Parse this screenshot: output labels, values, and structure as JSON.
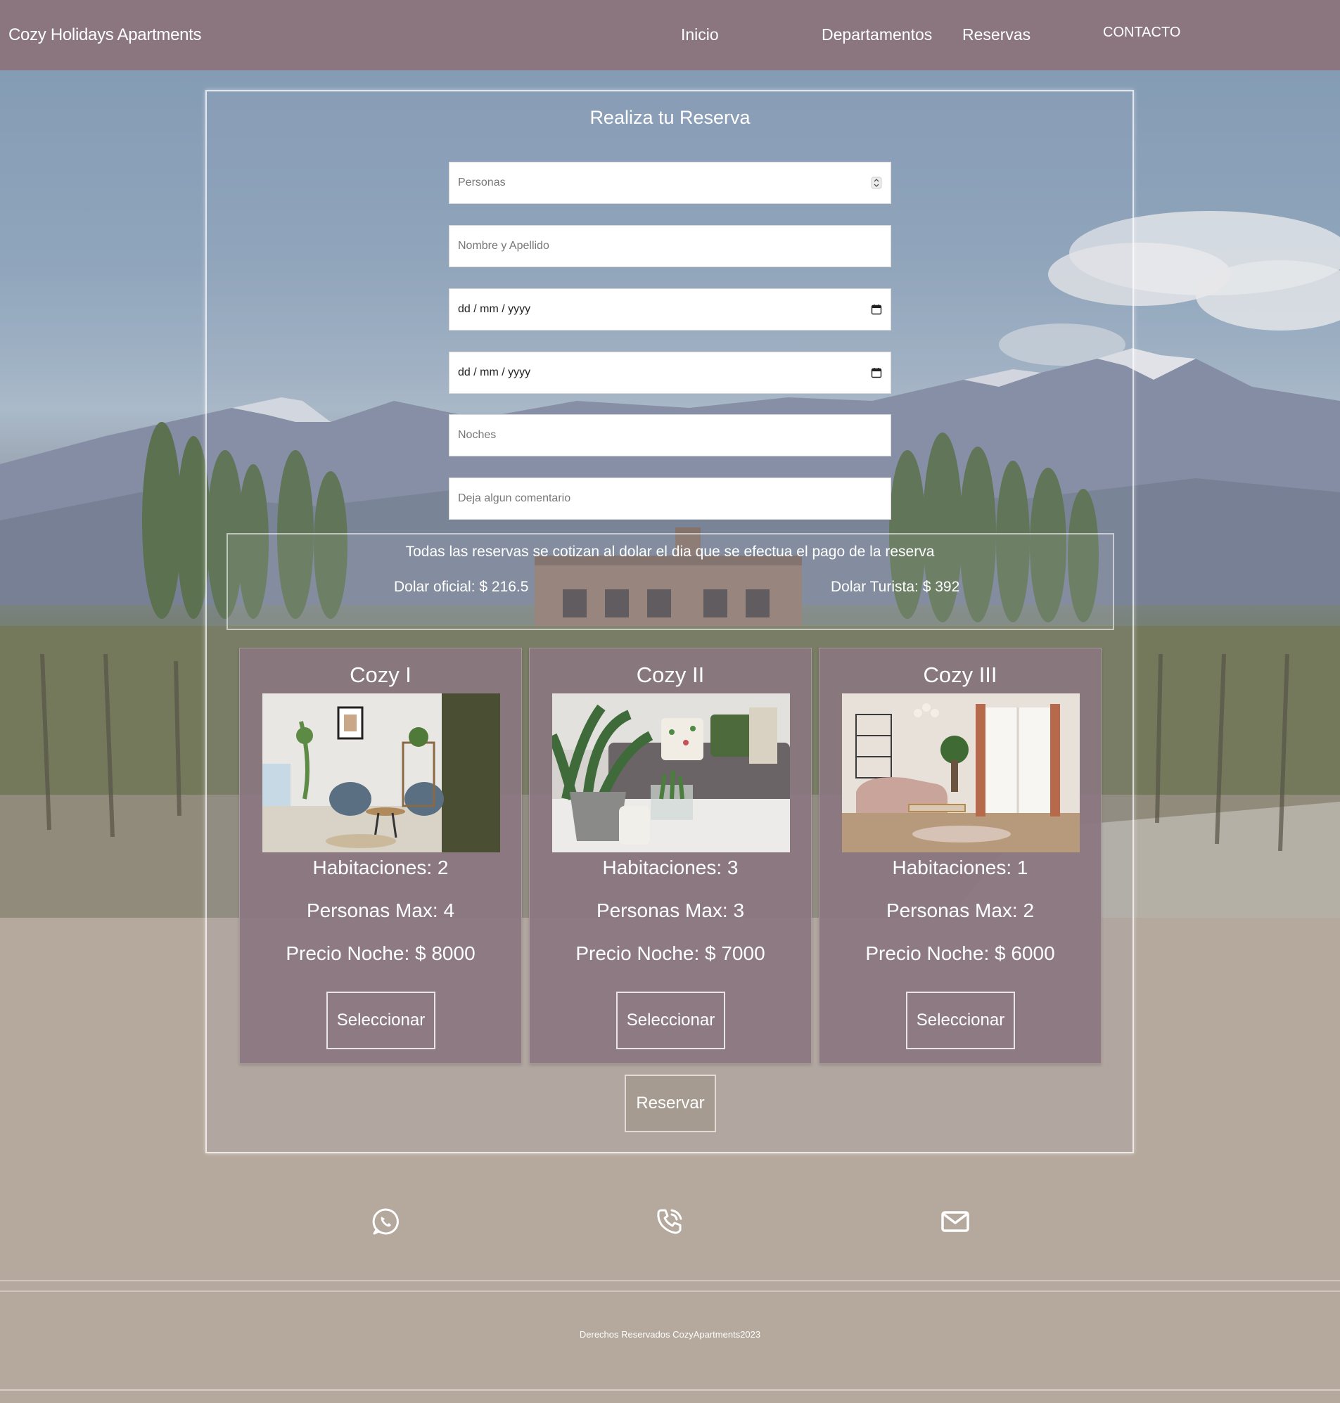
{
  "header": {
    "brand": "Cozy Holidays Apartments",
    "nav": {
      "inicio": "Inicio",
      "departamentos": "Departamentos",
      "reservas": "Reservas",
      "contacto": "CONTACTO"
    }
  },
  "form": {
    "title": "Realiza tu Reserva",
    "personas_placeholder": "Personas",
    "nombre_placeholder": "Nombre y Apellido",
    "fecha_entrada": "dd / mm / yyyy",
    "fecha_salida": "dd / mm / yyyy",
    "noches_placeholder": "Noches",
    "comentario_placeholder": "Deja algun comentario"
  },
  "notice": {
    "text": "Todas las reservas se cotizan al dolar el dia que se efectua el pago de la reserva",
    "dolar_oficial": "Dolar oficial: $ 216.5",
    "dolar_turista": "Dolar Turista: $ 392"
  },
  "apartments": [
    {
      "name": "Cozy I",
      "habitaciones": "Habitaciones: 2",
      "personas": "Personas Max: 4",
      "precio": "Precio Noche: $ 8000",
      "button": "Seleccionar"
    },
    {
      "name": "Cozy II",
      "habitaciones": "Habitaciones: 3",
      "personas": "Personas Max: 3",
      "precio": "Precio Noche: $ 7000",
      "button": "Seleccionar"
    },
    {
      "name": "Cozy III",
      "habitaciones": "Habitaciones: 1",
      "personas": "Personas Max: 2",
      "precio": "Precio Noche: $ 6000",
      "button": "Seleccionar"
    }
  ],
  "reserve_button": "Reservar",
  "contact_icons": [
    "whatsapp-icon",
    "phone-icon",
    "mail-icon"
  ],
  "footer": {
    "text": "Derechos Reservados CozyApartments2023"
  },
  "colors": {
    "header": "#8b7680",
    "card": "#8b7680",
    "page_background": "#b5a89d",
    "reserve_button": "#a69b90"
  }
}
